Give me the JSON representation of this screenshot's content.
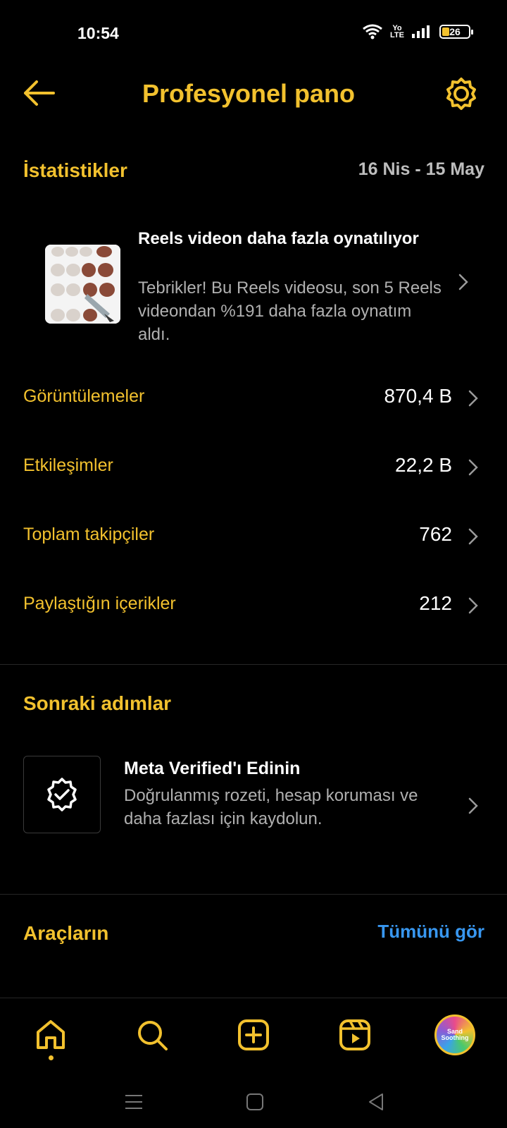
{
  "status_bar": {
    "time": "10:54",
    "volte_line1": "Yo",
    "volte_line2": "LTE",
    "battery_level": "26"
  },
  "header": {
    "title": "Profesyonel pano",
    "back_icon": "arrow-left-icon",
    "settings_icon": "gear-icon"
  },
  "statistics": {
    "title": "İstatistikler",
    "date_range": "16 Nis - 15 May",
    "reels_card": {
      "title": "Reels videon daha fazla oynatılıyor",
      "description": "Tebrikler! Bu Reels videosu, son 5 Reels videondan %191 daha fazla oynatım aldı."
    },
    "rows": [
      {
        "label": "Görüntülemeler",
        "value": "870,4 B"
      },
      {
        "label": "Etkileşimler",
        "value": "22,2 B"
      },
      {
        "label": "Toplam takipçiler",
        "value": "762"
      },
      {
        "label": "Paylaştığın içerikler",
        "value": "212"
      }
    ]
  },
  "next_steps": {
    "title": "Sonraki adımlar",
    "verified": {
      "title": "Meta Verified'ı Edinin",
      "description": "Doğrulanmış rozeti, hesap koruması ve daha fazlası için kaydolun.",
      "icon": "verified-badge-icon"
    }
  },
  "tools": {
    "title": "Araçların",
    "see_all": "Tümünü gör"
  },
  "bottom_nav": {
    "items": [
      "home-icon",
      "search-icon",
      "create-icon",
      "reels-icon",
      "profile-avatar"
    ],
    "avatar_text": "Sand Soothing"
  },
  "colors": {
    "accent": "#f2c12e",
    "link": "#3897f0",
    "background": "#000000",
    "muted": "#b0b0b0"
  }
}
